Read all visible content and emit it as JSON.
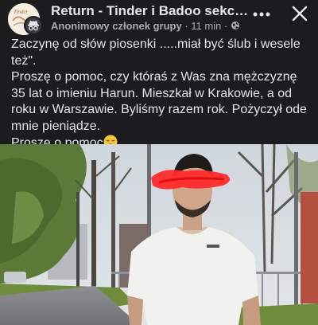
{
  "post": {
    "group_title": "Return - Tinder i Badoo sekcja ...",
    "author_role": "Anonimowy członek grupy",
    "separator": "·",
    "time_ago": "11 min",
    "privacy_icon": "globe-icon",
    "more_icon": "more-dots-icon",
    "close_icon": "close-icon",
    "avatar_text": "Tinder",
    "paragraphs": [
      "Zaczynę od słów piosenki .....miał być ślub i wesele też\".",
      "Proszę o pomoc, czy któraś z Was zna mężczyznę 35 lat o imieniu Harun.  Mieszkał w Krakowie,  a od roku w Warszawie. Byliśmy razem rok. Pożyczył ode mnie pieniądze.",
      "Proszę o pomoc"
    ],
    "emoji": "pensive-face-emoji"
  },
  "colors": {
    "background": "#1c1c1e",
    "text_primary": "#e4e6eb",
    "text_secondary": "#a8abaf",
    "redaction": "#ff2a2a"
  }
}
